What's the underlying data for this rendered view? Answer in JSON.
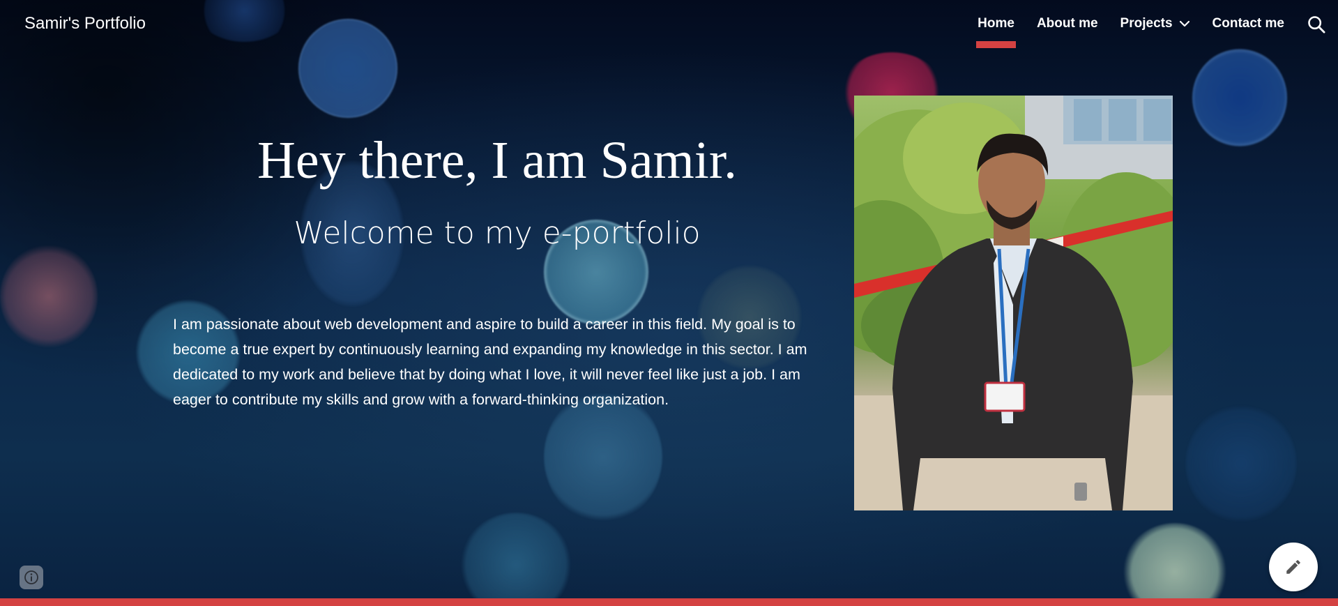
{
  "header": {
    "site_title": "Samir's Portfolio",
    "nav": {
      "home": "Home",
      "about": "About me",
      "projects": "Projects",
      "contact": "Contact me"
    },
    "active_tab": "Home",
    "search_icon": "search-icon",
    "projects_icon": "chevron-down-icon"
  },
  "hero": {
    "heading": "Hey there, I am Samir.",
    "subheading": "Welcome to my e-portfolio",
    "body": "I am passionate about web development and aspire to build a career in this field. My goal is to become a true expert by continuously learning and expanding my knowledge in this sector. I am dedicated to my work and believe that by doing what I love, it will never feel like just a job. I am eager to contribute my skills and grow with a forward-thinking organization."
  },
  "footer": {
    "info_icon": "info-icon",
    "edit_icon": "pencil-icon"
  },
  "colors": {
    "accent": "#d44242",
    "text": "#ffffff",
    "background": "#0b2546"
  }
}
